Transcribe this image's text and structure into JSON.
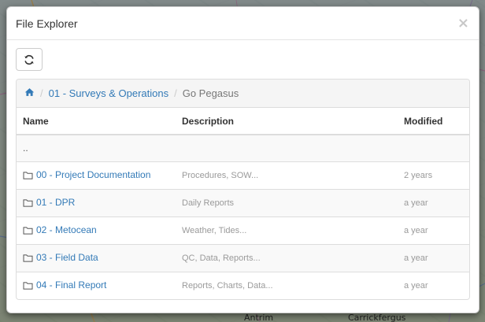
{
  "map": {
    "labels": [
      "Antrim",
      "Carrickfergus"
    ]
  },
  "modal": {
    "title": "File Explorer",
    "close_label": "×",
    "refresh_icon": "refresh-icon",
    "breadcrumb": {
      "home_icon": "home-icon",
      "items": [
        "01 - Surveys & Operations"
      ],
      "current": "Go Pegasus"
    },
    "table": {
      "headers": [
        "Name",
        "Description",
        "Modified"
      ],
      "up_label": "..",
      "rows": [
        {
          "name": "00 - Project Documentation",
          "description": "Procedures, SOW...",
          "modified": "2 years"
        },
        {
          "name": "01 - DPR",
          "description": "Daily Reports",
          "modified": "a year"
        },
        {
          "name": "02 - Metocean",
          "description": "Weather, Tides...",
          "modified": "a year"
        },
        {
          "name": "03 - Field Data",
          "description": "QC, Data, Reports...",
          "modified": "a year"
        },
        {
          "name": "04 - Final Report",
          "description": "Reports, Charts, Data...",
          "modified": "a year"
        }
      ]
    }
  }
}
